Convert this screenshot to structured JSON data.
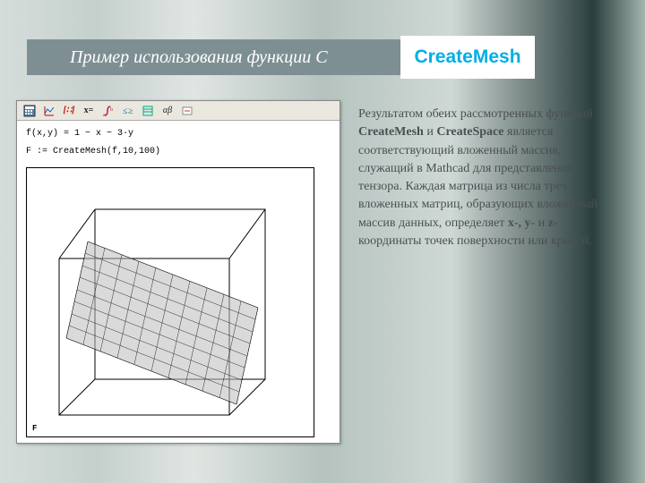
{
  "title": {
    "prefix": "Пример использования функции C",
    "badge": "CreateMesh"
  },
  "mathcad": {
    "formula_line1": "f(x,y) = 1 − x − 3·y",
    "formula_line2": "F := CreateMesh(f,10,100)",
    "plot_var": "F"
  },
  "toolbar": {
    "items": [
      "calc",
      "integral",
      "equal",
      "x-assign",
      "bracket",
      "matrix",
      "sigma",
      "alpha-beta",
      "chart"
    ]
  },
  "explanation": {
    "p1a": "Результатом обеих рассмотренных функций ",
    "b1": "CreateMesh",
    "p1b": " и ",
    "b2": "CreateSpace",
    "p1c": " является соответствующий вложенный массив, служащий в Mathcad для представления тензора. Каждая матрица из числа трех вложенных матриц, образующих вложенный массив данных, определяет ",
    "b3": "x-, y-",
    "p1d": " и ",
    "b4": "z-",
    "p1e": "координаты точек поверхности или кривой."
  }
}
